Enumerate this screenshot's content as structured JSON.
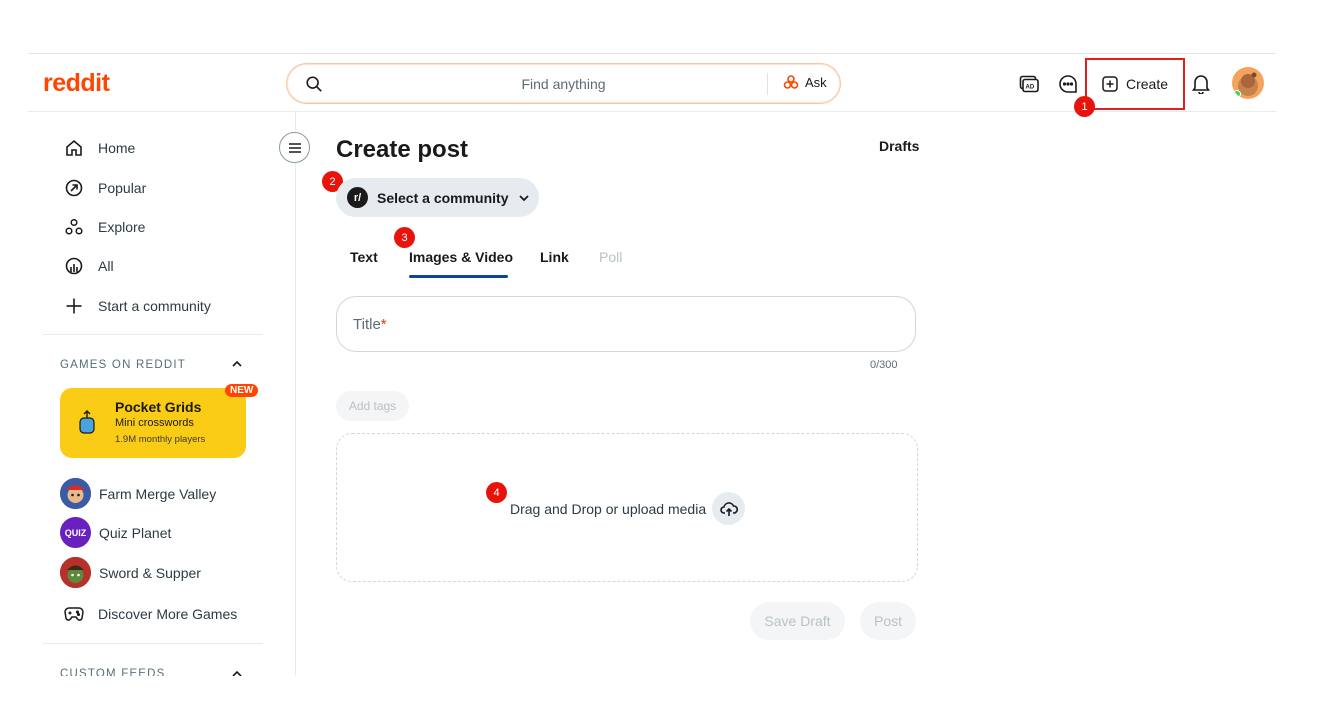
{
  "header": {
    "logo": "reddit",
    "search_placeholder": "Find anything",
    "ask_label": "Ask",
    "create_label": "Create"
  },
  "markers": [
    "1",
    "2",
    "3",
    "4"
  ],
  "sidebar": {
    "nav": [
      {
        "label": "Home",
        "icon": "home-icon"
      },
      {
        "label": "Popular",
        "icon": "popular-icon"
      },
      {
        "label": "Explore",
        "icon": "explore-icon"
      },
      {
        "label": "All",
        "icon": "all-icon"
      },
      {
        "label": "Start a community",
        "icon": "plus-icon"
      }
    ],
    "games_heading": "GAMES ON REDDIT",
    "featured_game": {
      "title": "Pocket Grids",
      "subtitle": "Mini crosswords",
      "players": "1.9M monthly players",
      "badge": "NEW"
    },
    "games": [
      {
        "label": "Farm Merge Valley",
        "color": "#3b5ba5"
      },
      {
        "label": "Quiz Planet",
        "avatar_text": "QUIZ",
        "color": "#6a1fbf"
      },
      {
        "label": "Sword & Supper",
        "color": "#b8302a"
      }
    ],
    "discover_label": "Discover More Games",
    "custom_feeds_heading": "CUSTOM FEEDS"
  },
  "main": {
    "title": "Create post",
    "drafts_label": "Drafts",
    "community_label": "Select a community",
    "community_logo": "r/",
    "tabs": [
      {
        "label": "Text"
      },
      {
        "label": "Images & Video"
      },
      {
        "label": "Link"
      },
      {
        "label": "Poll"
      }
    ],
    "title_placeholder": "Title",
    "title_required_mark": "*",
    "title_counter": "0/300",
    "add_tags_label": "Add tags",
    "dropzone_label": "Drag and Drop or upload media",
    "save_draft_label": "Save Draft",
    "post_label": "Post"
  },
  "colors": {
    "brand": "#ff4500",
    "active_tab": "#0a449b",
    "highlight_box": "#e02020",
    "marker": "#e8140c"
  }
}
